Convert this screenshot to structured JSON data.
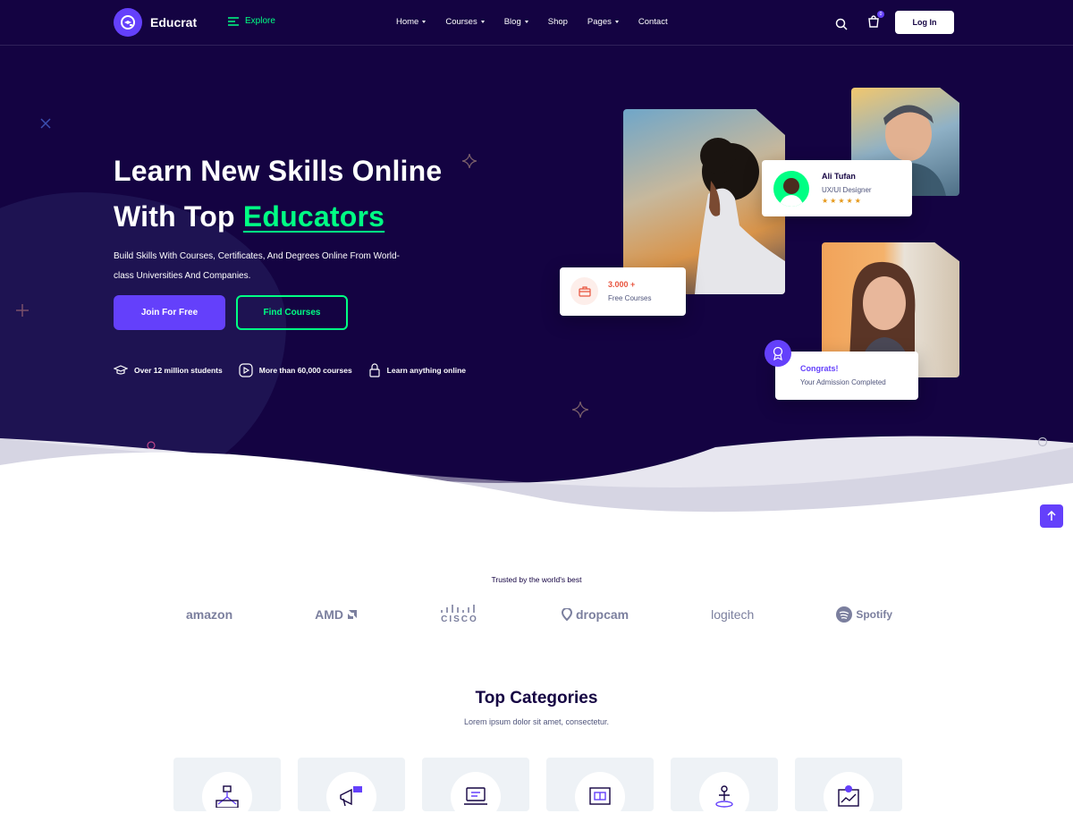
{
  "brand": {
    "name": "Educrat"
  },
  "nav": {
    "explore": "Explore",
    "items": [
      {
        "label": "Home",
        "dropdown": true
      },
      {
        "label": "Courses",
        "dropdown": true
      },
      {
        "label": "Blog",
        "dropdown": true
      },
      {
        "label": "Shop",
        "dropdown": false
      },
      {
        "label": "Pages",
        "dropdown": true
      },
      {
        "label": "Contact",
        "dropdown": false
      }
    ],
    "cart_count": "0",
    "login": "Log In"
  },
  "hero": {
    "title_line1": "Learn New Skills Online",
    "title_line2_prefix": "With Top ",
    "title_line2_accent": "Educators",
    "subtitle": "Build Skills With Courses, Certificates, And Degrees Online From World-class Universities And Companies.",
    "primary_button": "Join For Free",
    "secondary_button": "Find Courses",
    "features": [
      {
        "icon": "graduation-cap-icon",
        "label": "Over 12 million students"
      },
      {
        "icon": "play-circle-icon",
        "label": "More than 60,000 courses"
      },
      {
        "icon": "lock-icon",
        "label": "Learn anything online"
      }
    ]
  },
  "cards": {
    "instructor": {
      "name": "Ali Tufan",
      "role": "UX/UI Designer",
      "stars": 5
    },
    "courses": {
      "count": "3.000 +",
      "label": "Free Courses"
    },
    "congrats": {
      "title": "Congrats!",
      "text": "Your Admission Completed"
    }
  },
  "trusted": {
    "label": "Trusted by the world's best",
    "brands": [
      "amazon",
      "AMD",
      "CISCO",
      "dropcam",
      "logitech",
      "Spotify"
    ]
  },
  "categories": {
    "title": "Top Categories",
    "subtitle": "Lorem ipsum dolor sit amet, consectetur."
  },
  "colors": {
    "primary": "#6440fb",
    "accent": "#00ff84",
    "dark": "#140342"
  }
}
